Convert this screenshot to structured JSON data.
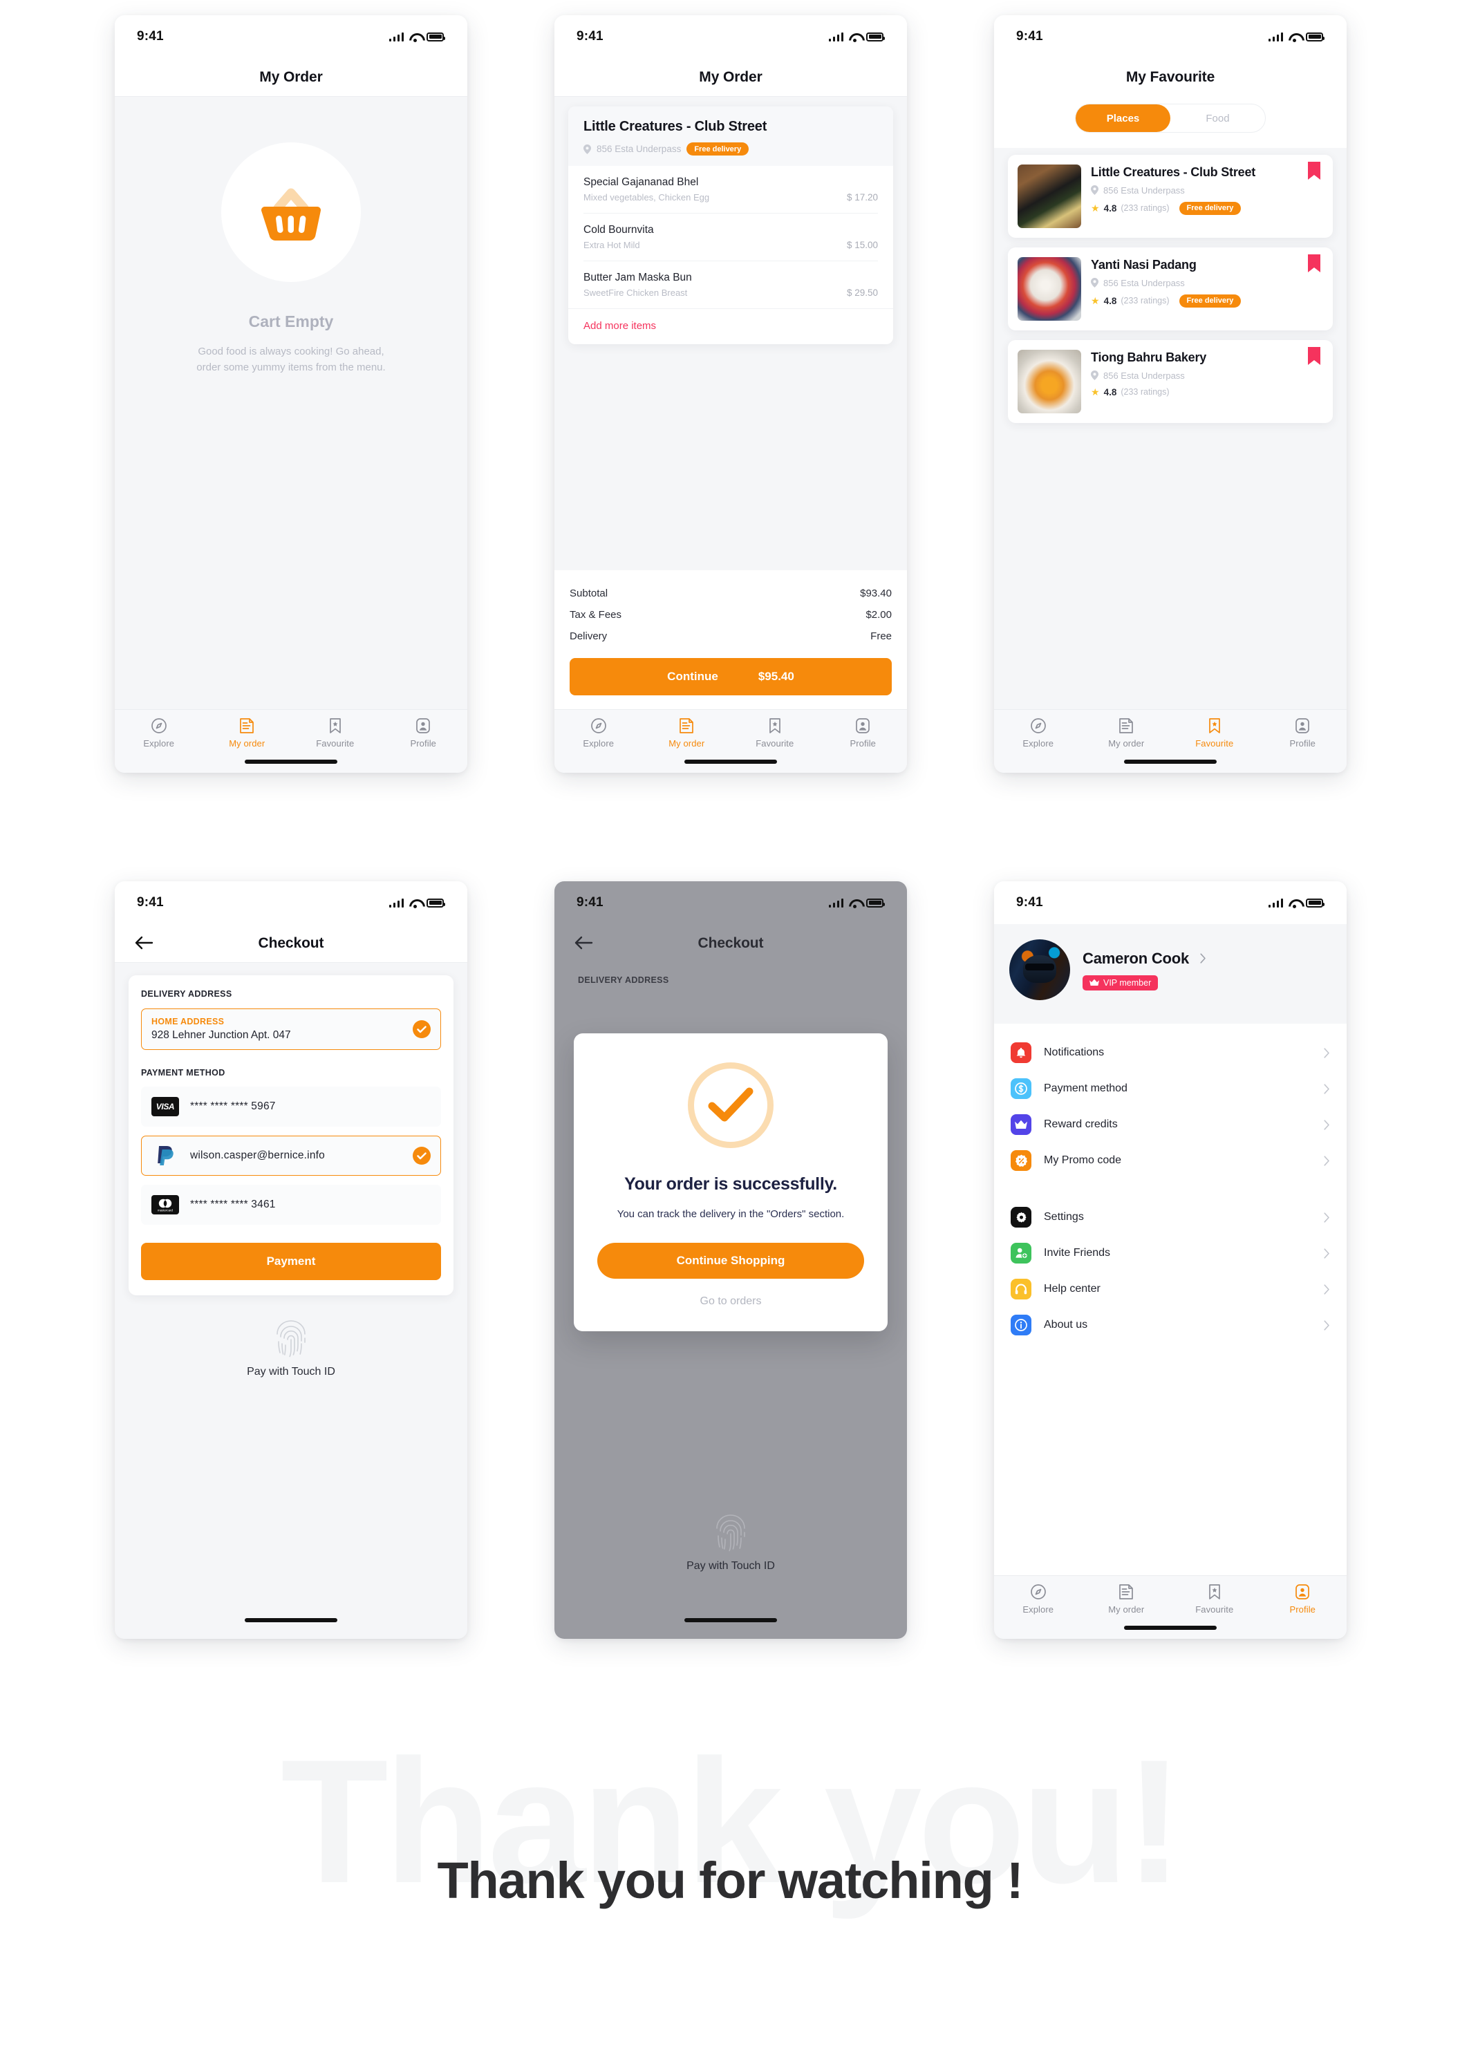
{
  "status_bar": {
    "time": "9:41",
    "signal_icon": "cellular-signal-icon",
    "wifi_icon": "wifi-icon",
    "battery_icon": "battery-icon"
  },
  "colors": {
    "accent": "#f68a0c",
    "accent_light": "#fbdcb0",
    "pink": "#f5335d",
    "dark": "#14151d",
    "muted": "#b9bcc6",
    "grey_overlay": "#9a9ba1"
  },
  "tabs": [
    {
      "label": "Explore",
      "icon": "compass-icon"
    },
    {
      "label": "My order",
      "icon": "receipt-icon"
    },
    {
      "label": "Favourite",
      "icon": "bookmark-star-icon"
    },
    {
      "label": "Profile",
      "icon": "person-badge-icon"
    }
  ],
  "screen_cart_empty": {
    "title": "My Order",
    "icon": "shopping-basket-icon",
    "heading": "Cart Empty",
    "message": "Good food is always cooking! Go ahead, order some yummy items from the menu.",
    "active_tab": "My order"
  },
  "screen_my_order": {
    "title": "My Order",
    "restaurant": {
      "name": "Little Creatures - Club Street",
      "address": "856 Esta Underpass",
      "badge": "Free delivery"
    },
    "items": [
      {
        "name": "Special Gajananad Bhel",
        "description": "Mixed vegetables, Chicken Egg",
        "price": "$ 17.20"
      },
      {
        "name": "Cold Bournvita",
        "description": "Extra Hot Mild",
        "price": "$ 15.00"
      },
      {
        "name": "Butter Jam Maska Bun",
        "description": "SweetFire Chicken Breast",
        "price": "$ 29.50"
      }
    ],
    "add_more_label": "Add more items",
    "totals": [
      {
        "label": "Subtotal",
        "value": "$93.40"
      },
      {
        "label": "Tax & Fees",
        "value": "$2.00"
      },
      {
        "label": "Delivery",
        "value": "Free"
      }
    ],
    "continue_label": "Continue",
    "continue_total": "$95.40",
    "active_tab": "My order"
  },
  "screen_favourite": {
    "title": "My Favourite",
    "segments": [
      {
        "label": "Places",
        "selected": true
      },
      {
        "label": "Food",
        "selected": false
      }
    ],
    "places": [
      {
        "name": "Little Creatures - Club Street",
        "address": "856 Esta Underpass",
        "rating": "4.8",
        "ratings_count": "(233 ratings)",
        "badge": "Free delivery",
        "has_badge": true,
        "bookmarked": true
      },
      {
        "name": "Yanti Nasi Padang",
        "address": "856 Esta Underpass",
        "rating": "4.8",
        "ratings_count": "(233 ratings)",
        "badge": "Free delivery",
        "has_badge": true,
        "bookmarked": true
      },
      {
        "name": "Tiong Bahru Bakery",
        "address": "856 Esta Underpass",
        "rating": "4.8",
        "ratings_count": "(233 ratings)",
        "badge": "",
        "has_badge": false,
        "bookmarked": true
      }
    ],
    "active_tab": "Favourite"
  },
  "screen_checkout": {
    "title": "Checkout",
    "back_icon": "arrow-left-icon",
    "delivery_address_label": "DELIVERY ADDRESS",
    "address_kind": "HOME ADDRESS",
    "address_value": "928 Lehner Junction Apt. 047",
    "payment_method_label": "PAYMENT METHOD",
    "payment_methods": [
      {
        "logo": "visa-icon",
        "text": "**** **** **** 5967",
        "selected": false
      },
      {
        "logo": "paypal-icon",
        "text": "wilson.casper@bernice.info",
        "selected": true
      },
      {
        "logo": "mastercard-icon",
        "text": "**** **** **** 3461",
        "selected": false
      }
    ],
    "pay_button": "Payment",
    "touch_id_label": "Pay with Touch ID",
    "touch_id_icon": "fingerprint-icon"
  },
  "screen_success": {
    "title": "Checkout",
    "back_icon": "arrow-left-icon",
    "delivery_address_label": "DELIVERY ADDRESS",
    "check_icon": "check-circle-icon",
    "heading": "Your order is successfully.",
    "message": "You can track the delivery in the \"Orders\" section.",
    "primary_button": "Continue Shopping",
    "secondary_link": "Go to orders",
    "touch_id_label": "Pay with Touch ID",
    "touch_id_icon": "fingerprint-icon"
  },
  "screen_profile": {
    "user_name": "Cameron Cook",
    "vip_badge": "VIP member",
    "vip_icon": "crown-icon",
    "avatar": "user-avatar",
    "menu_group_1": [
      {
        "label": "Notifications",
        "icon": "bell-icon",
        "color": "#f03a32"
      },
      {
        "label": "Payment method",
        "icon": "dollar-circle-icon",
        "color": "#4cc2fb"
      },
      {
        "label": "Reward credits",
        "icon": "crown-icon",
        "color": "#5344e8"
      },
      {
        "label": "My Promo code",
        "icon": "percent-badge-icon",
        "color": "#f68a0c"
      }
    ],
    "menu_group_2": [
      {
        "label": "Settings",
        "icon": "gear-icon",
        "color": "#111111"
      },
      {
        "label": "Invite Friends",
        "icon": "person-add-icon",
        "color": "#3ec35c"
      },
      {
        "label": "Help center",
        "icon": "headphones-icon",
        "color": "#fbc02b"
      },
      {
        "label": "About us",
        "icon": "info-circle-icon",
        "color": "#2f7cf6"
      }
    ],
    "active_tab": "Profile"
  },
  "footer": {
    "ghost_text": "Thank you!",
    "thanks_text": "Thank you for watching !"
  }
}
